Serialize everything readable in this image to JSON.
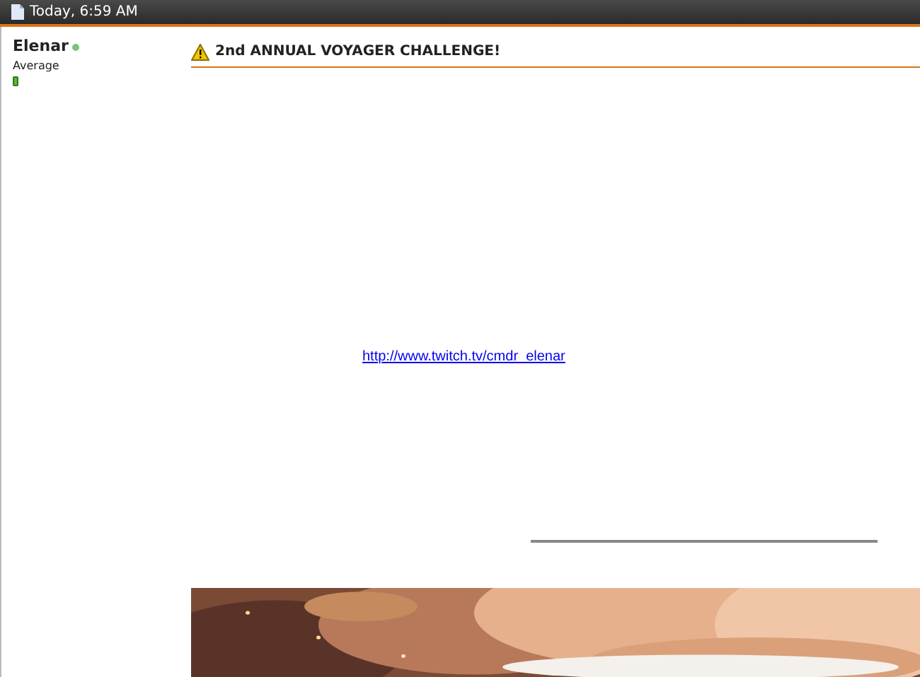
{
  "post_header": {
    "date": "Today, 6:59 AM"
  },
  "user": {
    "name": "Elenar",
    "online": true,
    "rank": "Average"
  },
  "post": {
    "title": "2nd ANNUAL VOYAGER CHALLENGE!",
    "link": "http://www.twitch.tv/cmdr_elenar"
  }
}
